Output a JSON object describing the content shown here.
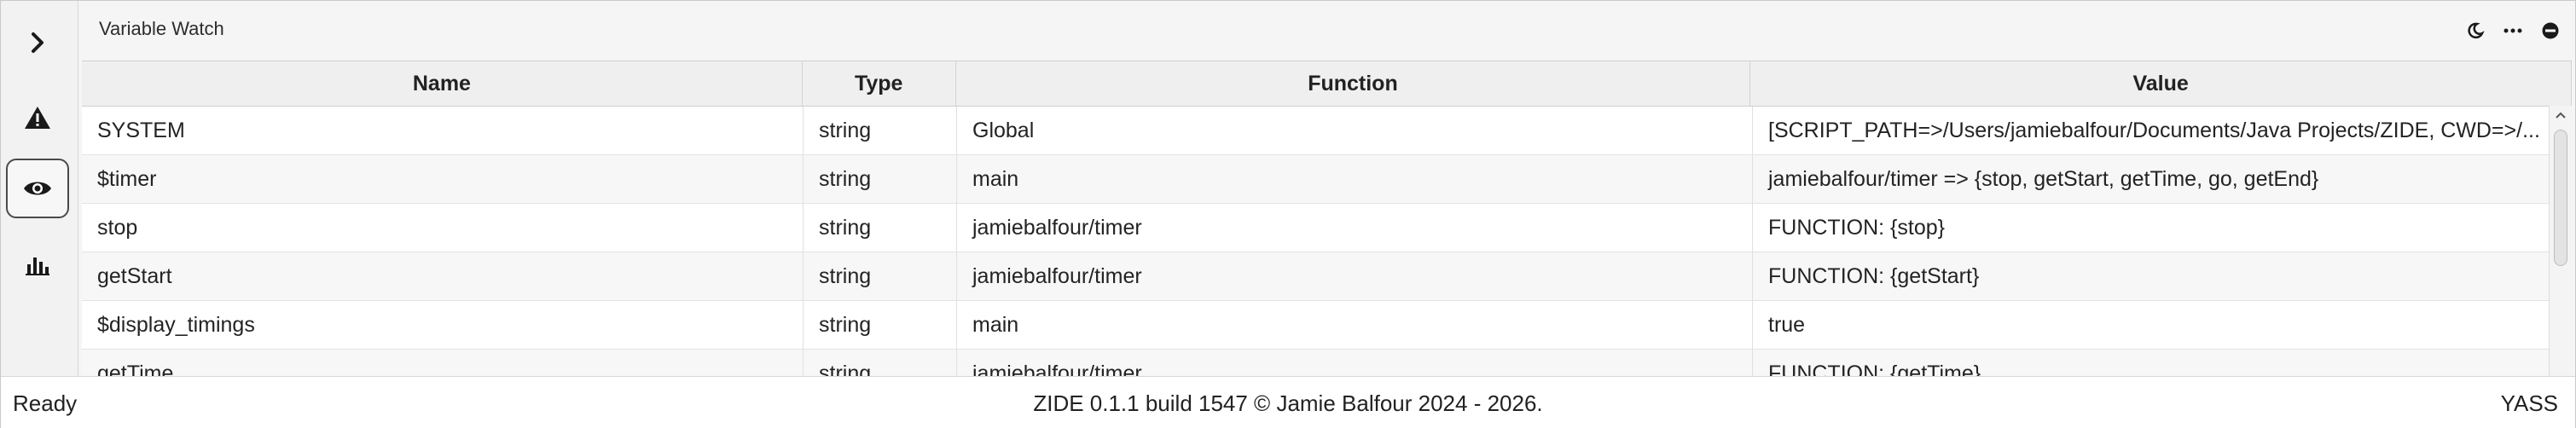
{
  "activity_bar": {
    "items": [
      {
        "icon": "chevron-right-icon",
        "active": false
      },
      {
        "icon": "warning-icon",
        "active": false
      },
      {
        "icon": "eye-icon",
        "active": true
      },
      {
        "icon": "bar-chart-icon",
        "active": false
      }
    ]
  },
  "panel": {
    "title": "Variable Watch",
    "actions": [
      "moon-icon",
      "more-icon",
      "stop-icon"
    ]
  },
  "table": {
    "columns": [
      "Name",
      "Type",
      "Function",
      "Value"
    ],
    "rows": [
      {
        "name": "SYSTEM",
        "type": "string",
        "function": "Global",
        "value": "[SCRIPT_PATH=>/Users/jamiebalfour/Documents/Java Projects/ZIDE, CWD=>/..."
      },
      {
        "name": "$timer",
        "type": "string",
        "function": "main",
        "value": "jamiebalfour/timer => {stop, getStart, getTime, go, getEnd}"
      },
      {
        "name": "stop",
        "type": "string",
        "function": "jamiebalfour/timer",
        "value": "FUNCTION: {stop}"
      },
      {
        "name": "getStart",
        "type": "string",
        "function": "jamiebalfour/timer",
        "value": "FUNCTION: {getStart}"
      },
      {
        "name": "$display_timings",
        "type": "string",
        "function": "main",
        "value": "true"
      },
      {
        "name": "getTime",
        "type": "string",
        "function": "jamiebalfour/timer",
        "value": "FUNCTION: {getTime}"
      }
    ]
  },
  "statusbar": {
    "left": "Ready",
    "center": "ZIDE 0.1.1 build 1547 © Jamie Balfour 2024 - 2026.",
    "right": "YASS"
  }
}
